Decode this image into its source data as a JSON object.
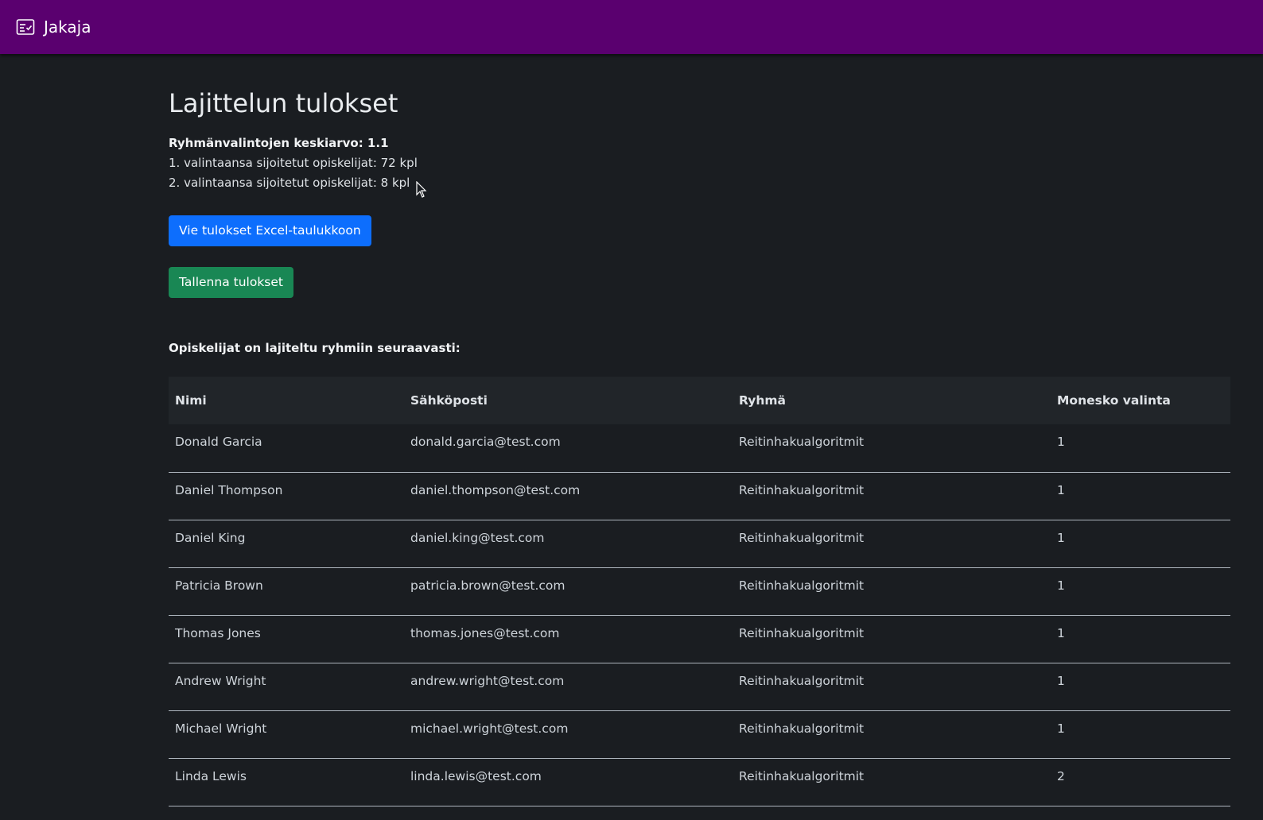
{
  "navbar": {
    "brand_text": "Jakaja",
    "brand_icon": "list-check-icon",
    "bg_color": "#5a006f"
  },
  "page": {
    "title": "Lajittelun tulokset",
    "average": "Ryhmänvalintojen keskiarvo: 1.1",
    "first_choice": "1. valintaansa sijoitetut opiskelijat: 72 kpl",
    "second_choice": "2. valintaansa sijoitetut opiskelijat: 8 kpl",
    "export_button": "Vie tulokset Excel-taulukkoon",
    "save_button": "Tallenna tulokset",
    "section_label": "Opiskelijat on lajiteltu ryhmiin seuraavasti:"
  },
  "table": {
    "headers": [
      "Nimi",
      "Sähköposti",
      "Ryhmä",
      "Monesko valinta"
    ],
    "rows": [
      [
        "Donald Garcia",
        "donald.garcia@test.com",
        "Reitinhakualgoritmit",
        "1"
      ],
      [
        "Daniel Thompson",
        "daniel.thompson@test.com",
        "Reitinhakualgoritmit",
        "1"
      ],
      [
        "Daniel King",
        "daniel.king@test.com",
        "Reitinhakualgoritmit",
        "1"
      ],
      [
        "Patricia Brown",
        "patricia.brown@test.com",
        "Reitinhakualgoritmit",
        "1"
      ],
      [
        "Thomas Jones",
        "thomas.jones@test.com",
        "Reitinhakualgoritmit",
        "1"
      ],
      [
        "Andrew Wright",
        "andrew.wright@test.com",
        "Reitinhakualgoritmit",
        "1"
      ],
      [
        "Michael Wright",
        "michael.wright@test.com",
        "Reitinhakualgoritmit",
        "1"
      ],
      [
        "Linda Lewis",
        "linda.lewis@test.com",
        "Reitinhakualgoritmit",
        "2"
      ]
    ]
  },
  "colors": {
    "background": "#1a1d21",
    "primary": "#0d6efd",
    "success": "#198754"
  }
}
